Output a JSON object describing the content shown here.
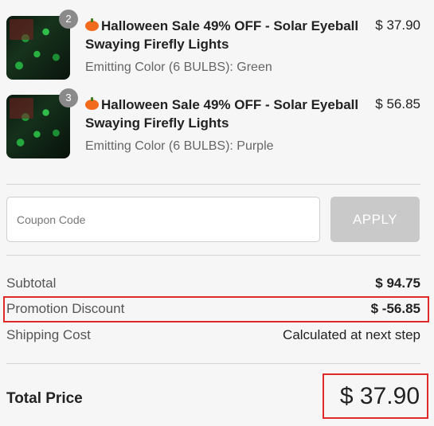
{
  "items": [
    {
      "badge": "2",
      "title": "Halloween Sale 49% OFF - Solar Eyeball Swaying Firefly Lights",
      "variant": "Emitting Color (6 BULBS): Green",
      "price": "$ 37.90"
    },
    {
      "badge": "3",
      "title": "Halloween Sale 49% OFF - Solar Eyeball Swaying Firefly Lights",
      "variant": "Emitting Color (6 BULBS): Purple",
      "price": "$ 56.85"
    }
  ],
  "coupon": {
    "placeholder": "Coupon Code",
    "apply_label": "APPLY"
  },
  "summary": {
    "subtotal_label": "Subtotal",
    "subtotal_value": "$ 94.75",
    "promo_label": "Promotion Discount",
    "promo_value": "$ -56.85",
    "shipping_label": "Shipping Cost",
    "shipping_value": "Calculated at next step",
    "total_label": "Total Price",
    "total_value": "$ 37.90"
  },
  "colors": {
    "highlight": "#e02a2a",
    "apply_disabled": "#c9c9c9",
    "background": "#f6f6f6"
  },
  "icons": [
    "pumpkin-icon"
  ]
}
